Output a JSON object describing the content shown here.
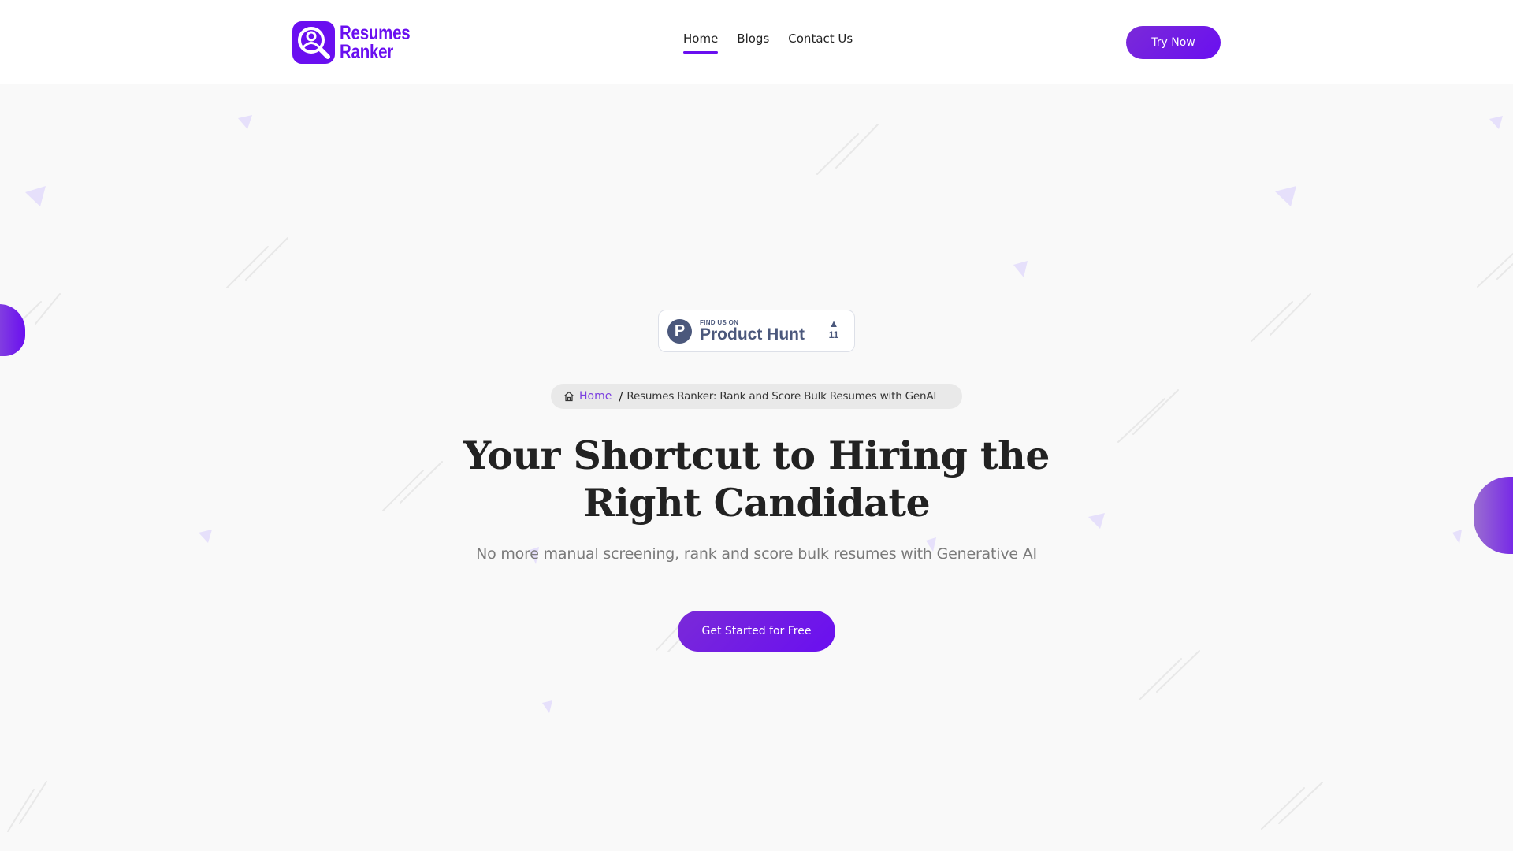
{
  "brand": {
    "name_line1": "Resumes",
    "name_line2": "Ranker",
    "logo_icon": "user-search-icon",
    "accent_color": "#6a0ff0"
  },
  "nav": {
    "items": [
      {
        "label": "Home",
        "active": true
      },
      {
        "label": "Blogs",
        "active": false
      },
      {
        "label": "Contact Us",
        "active": false
      }
    ],
    "cta_label": "Try Now"
  },
  "product_hunt": {
    "small_label": "FIND US ON",
    "big_label": "Product Hunt",
    "logo_letter": "P",
    "upvote_icon": "triangle-up-icon",
    "votes": "11"
  },
  "breadcrumb": {
    "home_icon": "home-icon",
    "home_label": "Home",
    "separator": "/",
    "current": "Resumes Ranker: Rank and Score Bulk Resumes with GenAI"
  },
  "hero": {
    "title_line1": "Your Shortcut to Hiring the",
    "title_line2": "Right Candidate",
    "subtitle": "No more manual screening, rank and score bulk resumes with Generative AI",
    "cta_label": "Get Started for Free"
  }
}
